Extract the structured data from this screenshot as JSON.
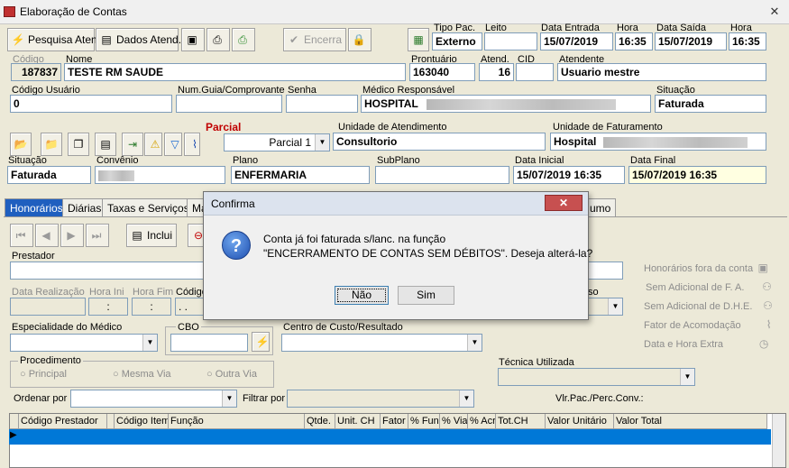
{
  "window": {
    "title": "Elaboração de Contas",
    "close_glyph": "✕"
  },
  "toolbar": {
    "pesquisa_atend": "Pesquisa Atend.",
    "dados_atend": "Dados Atend.",
    "encerra": "Encerra"
  },
  "header": {
    "tipo_pac": {
      "label": "Tipo Pac.",
      "value": "Externo"
    },
    "leito": {
      "label": "Leito",
      "value": ""
    },
    "data_entrada": {
      "label": "Data Entrada",
      "value": "15/07/2019"
    },
    "hora_entrada": {
      "label": "Hora",
      "value": "16:35"
    },
    "data_saida": {
      "label": "Data Saída",
      "value": "15/07/2019"
    },
    "hora_saida": {
      "label": "Hora",
      "value": "16:35"
    },
    "codigo": {
      "label": "Código",
      "value": "187837"
    },
    "nome": {
      "label": "Nome",
      "value": "TESTE RM SAUDE"
    },
    "prontuario": {
      "label": "Prontuário",
      "value": "163040"
    },
    "atend": {
      "label": "Atend.",
      "value": "16"
    },
    "cid": {
      "label": "CID",
      "value": ""
    },
    "atendente": {
      "label": "Atendente",
      "value": "Usuario mestre"
    },
    "codigo_usuario": {
      "label": "Código Usuário",
      "value": "0"
    },
    "num_guia": {
      "label": "Num.Guia/Comprovante",
      "value": ""
    },
    "senha": {
      "label": "Senha",
      "value": ""
    },
    "medico_responsavel": {
      "label": "Médico Responsável",
      "value": "HOSPITAL"
    },
    "situacao_top": {
      "label": "Situação",
      "value": "Faturada"
    }
  },
  "conta": {
    "parcial_label": "Parcial",
    "parcial_value": "Parcial 1",
    "unidade_atendimento": {
      "label": "Unidade de Atendimento",
      "value": "Consultorio"
    },
    "unidade_faturamento": {
      "label": "Unidade de Faturamento",
      "value": "Hospital"
    },
    "situacao": {
      "label": "Situação",
      "value": "Faturada"
    },
    "convenio": {
      "label": "Convênio",
      "value": ""
    },
    "plano": {
      "label": "Plano",
      "value": "ENFERMARIA"
    },
    "subplano": {
      "label": "SubPlano",
      "value": ""
    },
    "data_inicial": {
      "label": "Data Inicial",
      "value": "15/07/2019 16:35"
    },
    "data_final": {
      "label": "Data Final",
      "value": "15/07/2019 16:35"
    }
  },
  "tabs": [
    "Honorários",
    "Diárias",
    "Taxas e Serviços",
    "Ma",
    "umo"
  ],
  "honorarios": {
    "inclui_label": "Inclui",
    "prestador_label": "Prestador",
    "data_realizacao": "Data Realização",
    "hora_ini": "Hora Ini",
    "hora_fim": "Hora Fim",
    "codigo": "Código",
    "so_label": "so",
    "especialidade": "Especialidade do Médico",
    "cbo": "CBO",
    "centro_custo": "Centro de Custo/Resultado",
    "procedimento": "Procedimento",
    "principal": "Principal",
    "mesma_via": "Mesma Via",
    "outra_via": "Outra Via",
    "tecnica": "Técnica Utilizada",
    "ordenar_por": "Ordenar por",
    "filtrar_por": "Filtrar por",
    "vlr_pac": "Vlr.Pac./Perc.Conv.:"
  },
  "right_panel": [
    "Honorários fora da conta",
    "Sem Adicional de F. A.",
    "Sem Adicional de D.H.E.",
    "Fator de Acomodação",
    "Data e Hora Extra"
  ],
  "grid": {
    "columns": [
      "Código Prestador",
      "Código Item",
      "Função",
      "Qtde.",
      "Unit. CH",
      "Fator",
      "% Fun",
      "% Via",
      "% Acr",
      "Tot.CH",
      "Valor Unitário",
      "Valor Total"
    ]
  },
  "dialog": {
    "title": "Confirma",
    "line1": "Conta já foi faturada s/lanc. na função",
    "line2": "\"ENCERRAMENTO DE CONTAS SEM DÉBITOS\". Deseja alterá-la?",
    "no": "Não",
    "yes": "Sim"
  }
}
